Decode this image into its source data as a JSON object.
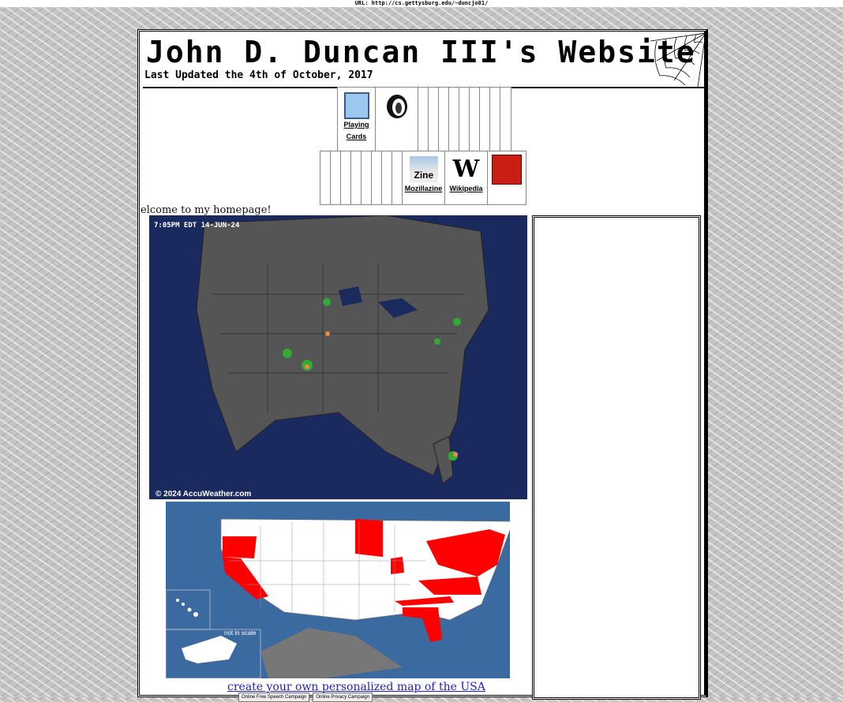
{
  "browser": {
    "url": "URL: http://cs.gettysburg.edu/~duncjo01/"
  },
  "header": {
    "title": "John D. Duncan III's Website",
    "updated": "Last Updated the 4th of October, 2017"
  },
  "links": {
    "playing_cards": "Playing\nCards",
    "mozillazine": "Mozillazine",
    "mozillazine_icon_text": "Zine",
    "wikipedia": "Wikipedia",
    "wikipedia_icon_text": "W"
  },
  "welcome": "elcome to my homepage!",
  "radar": {
    "timestamp": "7:05PM EDT 14-JUN-24",
    "copyright": "© 2024 AccuWeather.com"
  },
  "usa_map": {
    "not_in_scale": "not in scale",
    "link": "create your own personalized map of the USA"
  },
  "badges": [
    "Online Free Speech Campaign",
    "Online Privacy Campaign"
  ],
  "colors": {
    "visited_state": "#ff0000",
    "ocean": "#3a6aa0",
    "radar_bg": "#1a2a5e"
  }
}
